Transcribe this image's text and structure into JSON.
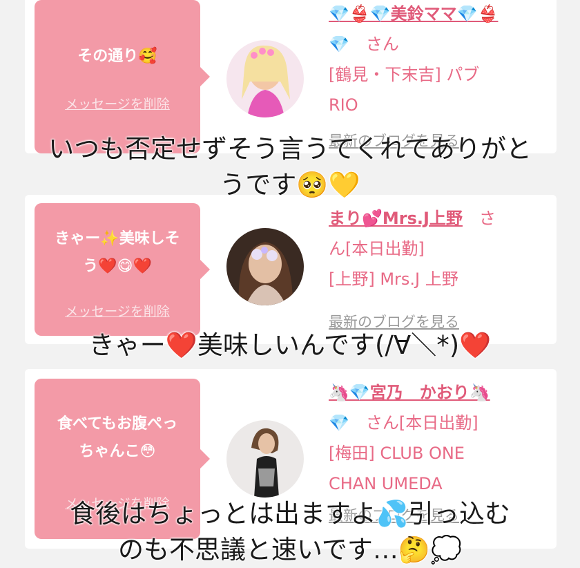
{
  "entries": [
    {
      "message": "その通り🥰",
      "delete_label": "メッセージを削除",
      "name": "💎👙💎美鈴ママ💎👙",
      "san_line": "💎　さん",
      "shop_lines": [
        "[鶴見・下末吉] パブ",
        "RIO"
      ],
      "blog_label": "最新のブログを見る",
      "caption_lines": [
        "いつも否定せずそう言うてくれてありがと",
        "うです🥺💛"
      ]
    },
    {
      "message_lines": [
        "きゃー✨美味しそ",
        "う❤️😋❤️"
      ],
      "delete_label": "メッセージを削除",
      "name": "まり💕Mrs.J上野",
      "name_suffix": "　さ",
      "san_line": "ん[本日出勤]",
      "shop_lines": [
        "[上野] Mrs.J 上野"
      ],
      "blog_label": "最新のブログを見る",
      "caption_lines": [
        "きゃー❤️美味しいんです(/∀＼*)❤️"
      ]
    },
    {
      "message_lines": [
        "食べてもお腹ぺっ",
        "ちゃんこ😳"
      ],
      "delete_label": "メッセージを削除",
      "name": "🦄💎宮乃　かおり🦄",
      "san_line": "💎　さん[本日出勤]",
      "shop_lines": [
        "[梅田] CLUB ONE",
        "CHAN UMEDA"
      ],
      "blog_label": "最新のブログを見る",
      "caption_lines": [
        "食後はちょっとは出ますよ💦引っ込む",
        "のも不思議と速いです…🤔💭"
      ]
    }
  ],
  "colors": {
    "background": "#f2f2f2",
    "card": "#ffffff",
    "bubble": "#f39aa7",
    "accent": "#e05a79"
  }
}
